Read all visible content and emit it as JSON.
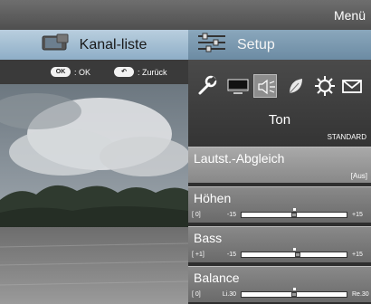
{
  "header": {
    "title": "Menü"
  },
  "tabs": [
    {
      "label": "Kanal-liste",
      "icon": "tv-icon"
    },
    {
      "label": "Setup",
      "icon": "equalizer-icon"
    }
  ],
  "hints": {
    "ok_button": "OK",
    "ok_label": ": OK",
    "back_label": ": Zurück"
  },
  "categories": [
    "wrench-icon",
    "picture-icon",
    "speaker-icon",
    "leaf-icon",
    "gear-icon",
    "envelope-icon"
  ],
  "selected_category": {
    "label": "Ton",
    "preset": "STANDARD"
  },
  "items": [
    {
      "title": "Lautst.-Abgleich",
      "value": "[Aus]"
    },
    {
      "title": "Höhen",
      "current": "[    0]",
      "min_label": "-15",
      "max_label": "+15",
      "level": 0.5
    },
    {
      "title": "Bass",
      "current": "[  +1]",
      "min_label": "-15",
      "max_label": "+15",
      "level": 0.533
    },
    {
      "title": "Balance",
      "current": "[    0]",
      "min_label": "Li.30",
      "max_label": "Re.30",
      "level": 0.5
    }
  ]
}
